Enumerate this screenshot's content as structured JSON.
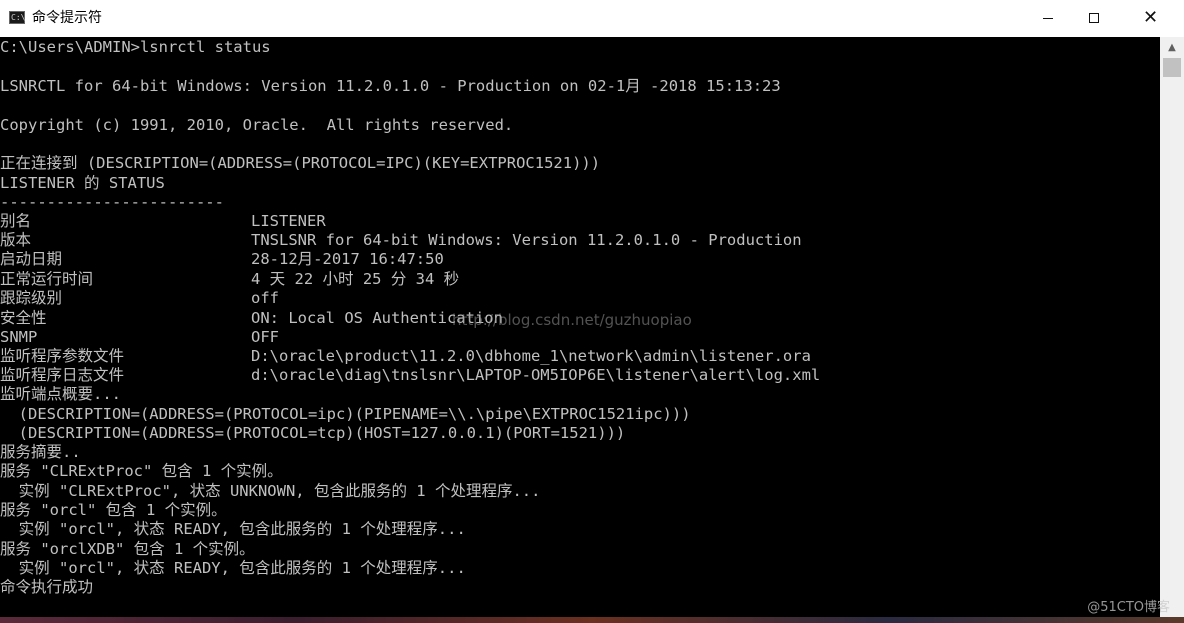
{
  "window": {
    "title": "命令提示符",
    "icon": "cmd-icon",
    "icon_glyph": "C:\\"
  },
  "controls": {
    "minimize": "minimize-icon",
    "maximize": "maximize-icon",
    "close": "close-icon",
    "close_glyph": "✕"
  },
  "console": {
    "lines": [
      "C:\\Users\\ADMIN>lsnrctl status",
      "",
      "LSNRCTL for 64-bit Windows: Version 11.2.0.1.0 - Production on 02-1月 -2018 15:13:23",
      "",
      "Copyright (c) 1991, 2010, Oracle.  All rights reserved.",
      "",
      "正在连接到 (DESCRIPTION=(ADDRESS=(PROTOCOL=IPC)(KEY=EXTPROC1521)))",
      "LISTENER 的 STATUS",
      "------------------------"
    ],
    "status_rows": [
      {
        "label": "别名",
        "value": "LISTENER"
      },
      {
        "label": "版本",
        "value": "TNSLSNR for 64-bit Windows: Version 11.2.0.1.0 - Production"
      },
      {
        "label": "启动日期",
        "value": "28-12月-2017 16:47:50"
      },
      {
        "label": "正常运行时间",
        "value": "4 天 22 小时 25 分 34 秒"
      },
      {
        "label": "跟踪级别",
        "value": "off"
      },
      {
        "label": "安全性",
        "value": "ON: Local OS Authentication"
      },
      {
        "label": "SNMP",
        "value": "OFF"
      },
      {
        "label": "监听程序参数文件",
        "value": "D:\\oracle\\product\\11.2.0\\dbhome_1\\network\\admin\\listener.ora"
      },
      {
        "label": "监听程序日志文件",
        "value": "d:\\oracle\\diag\\tnslsnr\\LAPTOP-OM5IOP6E\\listener\\alert\\log.xml"
      }
    ],
    "tail_lines": [
      "监听端点概要...",
      "  (DESCRIPTION=(ADDRESS=(PROTOCOL=ipc)(PIPENAME=\\\\.\\pipe\\EXTPROC1521ipc)))",
      "  (DESCRIPTION=(ADDRESS=(PROTOCOL=tcp)(HOST=127.0.0.1)(PORT=1521)))",
      "服务摘要..",
      "服务 \"CLRExtProc\" 包含 1 个实例。",
      "  实例 \"CLRExtProc\", 状态 UNKNOWN, 包含此服务的 1 个处理程序...",
      "服务 \"orcl\" 包含 1 个实例。",
      "  实例 \"orcl\", 状态 READY, 包含此服务的 1 个处理程序...",
      "服务 \"orclXDB\" 包含 1 个实例。",
      "  实例 \"orcl\", 状态 READY, 包含此服务的 1 个处理程序...",
      "命令执行成功"
    ],
    "watermark": "http://blog.csdn.net/guzhuopiao"
  },
  "scrollbar": {
    "up_arrow": "▲",
    "icon": "scroll-up-arrow-icon"
  },
  "corner_watermark": "@51CTO博客"
}
